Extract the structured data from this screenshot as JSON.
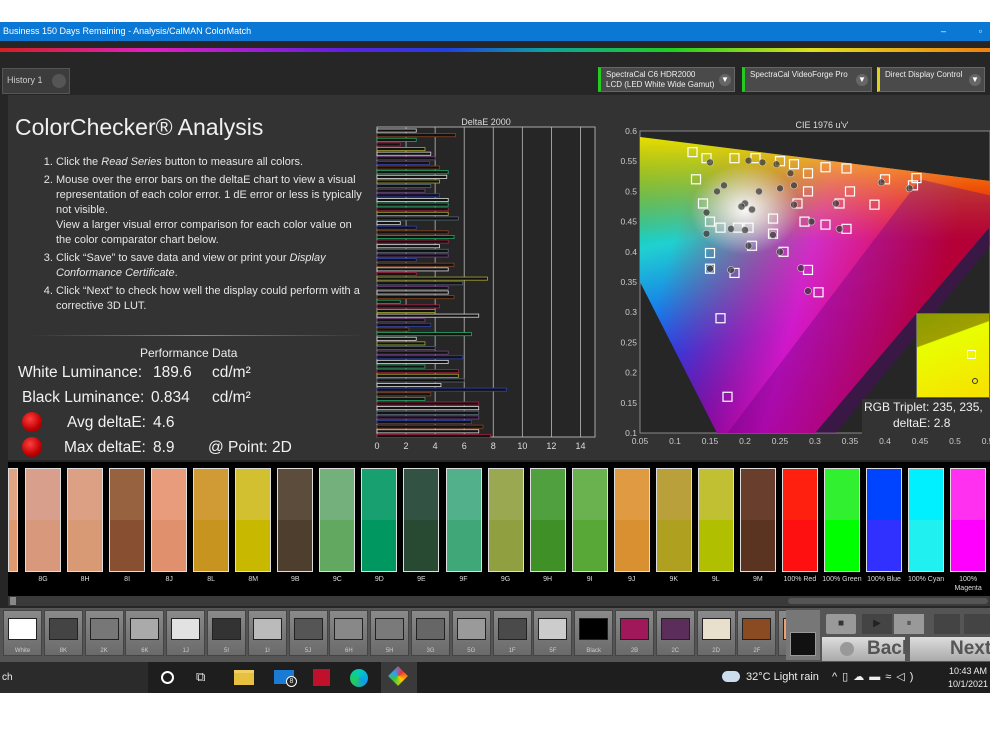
{
  "window": {
    "title": "Business 150 Days Remaining  - Analysis/CalMAN ColorMatch",
    "min": "–",
    "max": "▫"
  },
  "tabs": [
    {
      "label": "History 1"
    }
  ],
  "devices": [
    {
      "line1": "SpectraCal C6 HDR2000",
      "line2": "LCD (LED White Wide Gamut)",
      "accent": "#22cc22"
    },
    {
      "line1": "SpectraCal VideoForge Pro",
      "line2": "",
      "accent": "#22cc22"
    },
    {
      "line1": "Direct Display Control",
      "line2": "",
      "accent": "#e0d020"
    }
  ],
  "page": {
    "title": "ColorChecker® Analysis",
    "steps": [
      {
        "pre": "Click the ",
        "em": "Read Series",
        "post": " button to measure all colors."
      },
      {
        "pre": "Mouse over the error bars on the deltaE chart to view a visual representation of each color error. 1 dE error or less is typically not visible.",
        "em": "",
        "post": ""
      },
      {
        "pre": "Click “Save” to save data and view or print your ",
        "em": "Display Conformance Certificate",
        "post": "."
      },
      {
        "pre": "Click “Next” to check how well the display could perform with a corrective 3D LUT.",
        "em": "",
        "post": ""
      }
    ],
    "step2_extra": "View a larger visual error comparison for each color value on the color comparator chart below."
  },
  "performance": {
    "heading": "Performance Data",
    "white_label": "White Luminance:",
    "white_value": "189.6",
    "white_unit": "cd/m²",
    "black_label": "Black Luminance:",
    "black_value": "0.834",
    "black_unit": "cd/m²",
    "avg_label": "Avg deltaE:",
    "avg_value": "4.6",
    "max_label": "Max deltaE:",
    "max_value": "8.9",
    "point_label": "@ Point: 2D",
    "status_color": "#dd0000"
  },
  "chart_data": [
    {
      "type": "bar",
      "orientation": "horizontal",
      "title": "DeltaE 2000",
      "xlim": [
        0,
        15
      ],
      "xticks": [
        "0",
        "2",
        "4",
        "6",
        "8",
        "10",
        "12",
        "14"
      ],
      "grid": true,
      "values": [
        2.7,
        5.4,
        2.7,
        1.6,
        3.3,
        3.7,
        4.0,
        3.6,
        4.3,
        4.9,
        4.8,
        4.3,
        3.7,
        3.3,
        4.3,
        4.9,
        4.9,
        4.9,
        4.9,
        5.6,
        1.6,
        2.7,
        4.9,
        5.3,
        4.9,
        4.3,
        4.9,
        4.9,
        2.7,
        5.3,
        4.9,
        2.7,
        7.6,
        5.9,
        4.9,
        4.9,
        5.3,
        1.6,
        4.3,
        4.0,
        7.0,
        3.3,
        3.7,
        2.2,
        6.5,
        2.7,
        3.3,
        4.0,
        4.9,
        5.9,
        4.9,
        3.3,
        5.6,
        5.6,
        6.0,
        4.4,
        8.9,
        3.7,
        3.3,
        7.0,
        7.0,
        7.0,
        7.0,
        6.5,
        7.3,
        7.0,
        7.8
      ]
    },
    {
      "type": "scatter",
      "title": "CIE 1976 u'v'",
      "xlim": [
        0.05,
        0.55
      ],
      "ylim": [
        0.1,
        0.6
      ],
      "xticks": [
        "0.05",
        "0.1",
        "0.15",
        "0.2",
        "0.25",
        "0.3",
        "0.35",
        "0.4",
        "0.45",
        "0.5",
        "0.55"
      ],
      "yticks": [
        "0.1",
        "0.15",
        "0.2",
        "0.25",
        "0.3",
        "0.35",
        "0.4",
        "0.45",
        "0.5",
        "0.55",
        "0.6"
      ],
      "targets": [
        [
          0.125,
          0.565
        ],
        [
          0.145,
          0.555
        ],
        [
          0.185,
          0.555
        ],
        [
          0.215,
          0.555
        ],
        [
          0.25,
          0.55
        ],
        [
          0.27,
          0.545
        ],
        [
          0.315,
          0.54
        ],
        [
          0.345,
          0.538
        ],
        [
          0.4,
          0.52
        ],
        [
          0.445,
          0.522
        ],
        [
          0.13,
          0.52
        ],
        [
          0.14,
          0.48
        ],
        [
          0.29,
          0.53
        ],
        [
          0.29,
          0.5
        ],
        [
          0.35,
          0.5
        ],
        [
          0.385,
          0.478
        ],
        [
          0.335,
          0.48
        ],
        [
          0.15,
          0.45
        ],
        [
          0.165,
          0.44
        ],
        [
          0.19,
          0.44
        ],
        [
          0.205,
          0.44
        ],
        [
          0.24,
          0.455
        ],
        [
          0.285,
          0.45
        ],
        [
          0.315,
          0.445
        ],
        [
          0.345,
          0.438
        ],
        [
          0.24,
          0.43
        ],
        [
          0.21,
          0.41
        ],
        [
          0.255,
          0.4
        ],
        [
          0.15,
          0.398
        ],
        [
          0.15,
          0.372
        ],
        [
          0.185,
          0.365
        ],
        [
          0.29,
          0.37
        ],
        [
          0.305,
          0.333
        ],
        [
          0.165,
          0.29
        ],
        [
          0.175,
          0.16
        ],
        [
          0.44,
          0.51
        ],
        [
          0.275,
          0.48
        ]
      ],
      "measured": [
        [
          0.15,
          0.548
        ],
        [
          0.205,
          0.551
        ],
        [
          0.225,
          0.548
        ],
        [
          0.245,
          0.545
        ],
        [
          0.265,
          0.53
        ],
        [
          0.27,
          0.51
        ],
        [
          0.25,
          0.505
        ],
        [
          0.22,
          0.5
        ],
        [
          0.2,
          0.48
        ],
        [
          0.195,
          0.475
        ],
        [
          0.21,
          0.47
        ],
        [
          0.145,
          0.465
        ],
        [
          0.16,
          0.5
        ],
        [
          0.17,
          0.51
        ],
        [
          0.145,
          0.43
        ],
        [
          0.18,
          0.438
        ],
        [
          0.2,
          0.436
        ],
        [
          0.24,
          0.428
        ],
        [
          0.205,
          0.41
        ],
        [
          0.25,
          0.4
        ],
        [
          0.15,
          0.372
        ],
        [
          0.18,
          0.37
        ],
        [
          0.28,
          0.373
        ],
        [
          0.295,
          0.45
        ],
        [
          0.335,
          0.438
        ],
        [
          0.33,
          0.48
        ],
        [
          0.435,
          0.505
        ],
        [
          0.395,
          0.515
        ],
        [
          0.27,
          0.478
        ],
        [
          0.29,
          0.335
        ]
      ]
    },
    {
      "type": "inset",
      "rgb_triplet_label": "RGB Triplet: 235, 235, ",
      "deltae_label": "deltaE: 2.8"
    }
  ],
  "swatches": [
    {
      "label": "",
      "measured": "#e0a484",
      "target": "#e09a70"
    },
    {
      "label": "8G",
      "measured": "#d8a08c",
      "target": "#d8987c"
    },
    {
      "label": "8H",
      "measured": "#dca084",
      "target": "#d89a74"
    },
    {
      "label": "8I",
      "measured": "#966240",
      "target": "#885030"
    },
    {
      "label": "8J",
      "measured": "#e89c7c",
      "target": "#e0906c"
    },
    {
      "label": "8L",
      "measured": "#d09a34",
      "target": "#c89420"
    },
    {
      "label": "8M",
      "measured": "#d2c030",
      "target": "#c8b800"
    },
    {
      "label": "9B",
      "measured": "#5c4c3c",
      "target": "#4e3e2e"
    },
    {
      "label": "9C",
      "measured": "#74b07c",
      "target": "#62a860"
    },
    {
      "label": "9D",
      "measured": "#18a070",
      "target": "#009860"
    },
    {
      "label": "9E",
      "measured": "#325244",
      "target": "#284a32"
    },
    {
      "label": "9F",
      "measured": "#52b08a",
      "target": "#40a878"
    },
    {
      "label": "9G",
      "measured": "#9aa852",
      "target": "#90a040"
    },
    {
      "label": "9H",
      "measured": "#50a040",
      "target": "#409028"
    },
    {
      "label": "9I",
      "measured": "#6ab250",
      "target": "#58a838"
    },
    {
      "label": "9J",
      "measured": "#e09a42",
      "target": "#d89030"
    },
    {
      "label": "9K",
      "measured": "#baa03a",
      "target": "#b0a020"
    },
    {
      "label": "9L",
      "measured": "#c0c032",
      "target": "#b0c000"
    },
    {
      "label": "9M",
      "measured": "#6a3e2c",
      "target": "#5a3420"
    },
    {
      "label": "100% Red",
      "measured": "#ff2010",
      "target": "#ff1010"
    },
    {
      "label": "100% Green",
      "measured": "#30f030",
      "target": "#00ff00"
    },
    {
      "label": "100% Blue",
      "measured": "#0044ff",
      "target": "#3030ff"
    },
    {
      "label": "100% Cyan",
      "measured": "#00f0ff",
      "target": "#20f0f0"
    },
    {
      "label": "100% Magenta",
      "measured": "#ff30f0",
      "target": "#ff00ff"
    }
  ],
  "series_buttons": [
    {
      "label": "White",
      "color": "#ffffff"
    },
    {
      "label": "8K",
      "color": "#444444"
    },
    {
      "label": "2K",
      "color": "#777777"
    },
    {
      "label": "6K",
      "color": "#aaaaaa"
    },
    {
      "label": "1J",
      "color": "#e2e2e2"
    },
    {
      "label": "5I",
      "color": "#333333"
    },
    {
      "label": "1I",
      "color": "#bbbbbb"
    },
    {
      "label": "5J",
      "color": "#555555"
    },
    {
      "label": "6H",
      "color": "#888888"
    },
    {
      "label": "5H",
      "color": "#7a7a7a"
    },
    {
      "label": "3G",
      "color": "#666666"
    },
    {
      "label": "5G",
      "color": "#9a9a9a"
    },
    {
      "label": "1F",
      "color": "#4a4a4a"
    },
    {
      "label": "5F",
      "color": "#cccccc"
    },
    {
      "label": "Black",
      "color": "#000000"
    },
    {
      "label": "2B",
      "color": "#a0175a"
    },
    {
      "label": "2C",
      "color": "#5a2d5a"
    },
    {
      "label": "2D",
      "color": "#e8e0cc"
    },
    {
      "label": "2F",
      "color": "#8a4a22"
    },
    {
      "label": "",
      "color": "#f0a070"
    }
  ],
  "controls": {
    "back": "Back",
    "next": "Next"
  },
  "taskbar": {
    "search": "ch",
    "weather": "32°C  Light rain",
    "time": "10:43 AM",
    "date": "10/1/2021",
    "mail_badge": "8"
  }
}
